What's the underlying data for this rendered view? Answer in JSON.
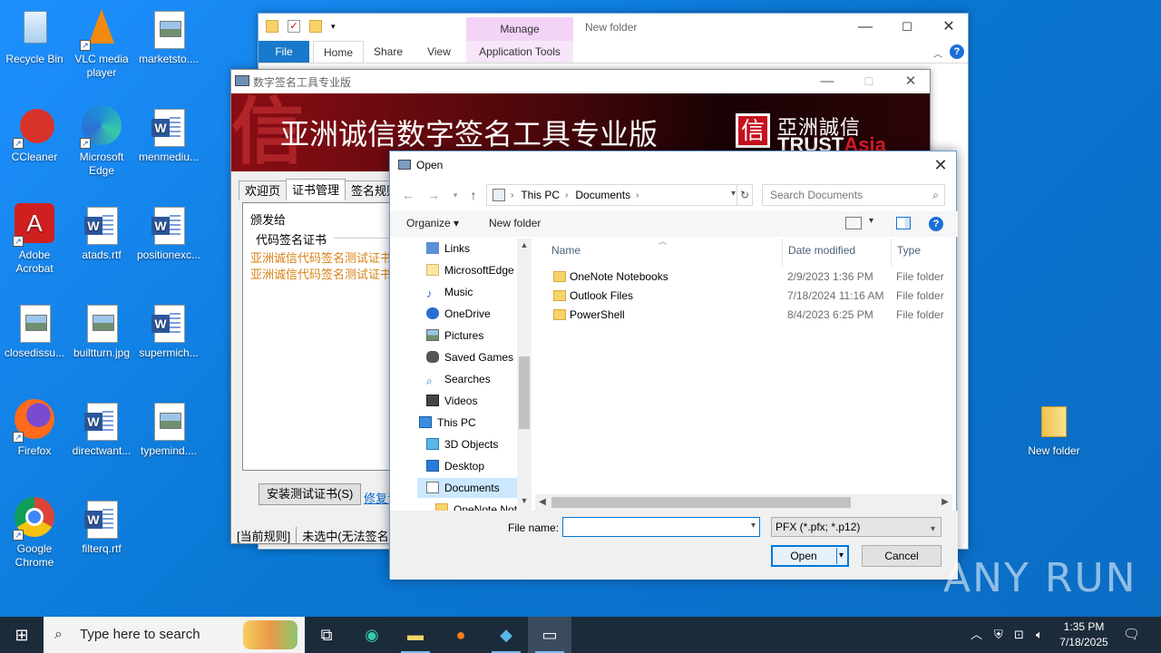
{
  "desktop": {
    "icons": [
      {
        "label": "Recycle Bin"
      },
      {
        "label": "VLC media player"
      },
      {
        "label": "marketsto...."
      },
      {
        "label": "CCleaner"
      },
      {
        "label": "Microsoft Edge"
      },
      {
        "label": "menmediu..."
      },
      {
        "label": "Adobe Acrobat"
      },
      {
        "label": "atads.rtf"
      },
      {
        "label": "positionexc..."
      },
      {
        "label": "closedissu..."
      },
      {
        "label": "builtturn.jpg"
      },
      {
        "label": "supermich..."
      },
      {
        "label": "Firefox"
      },
      {
        "label": "directwant..."
      },
      {
        "label": "typemind...."
      },
      {
        "label": "Google Chrome"
      },
      {
        "label": "filterq.rtf"
      },
      {
        "label": "New folder"
      }
    ]
  },
  "explorer": {
    "caption": "New folder",
    "manage_tab": "Manage",
    "tabs": {
      "file": "File",
      "home": "Home",
      "share": "Share",
      "view": "View",
      "app_tools": "Application Tools"
    }
  },
  "signapp": {
    "title": "数字签名工具专业版",
    "banner_title": "亚洲诚信数字签名工具专业版",
    "logo_cn": "亞洲誠信",
    "logo_en_a": "TRUST",
    "logo_en_b": "Asia",
    "tabs": [
      "欢迎页",
      "证书管理",
      "签名规则"
    ],
    "panel": {
      "label": "颁发给",
      "group": "代码签名证书",
      "entries": [
        "亚洲诚信代码签名测试证书",
        "亚洲诚信代码签名测试证书"
      ]
    },
    "install_button": "安装测试证书(S)",
    "link": "修复证",
    "status": [
      "[当前规则]",
      "未选中(无法签名"
    ]
  },
  "dialog": {
    "title": "Open",
    "address": [
      "This PC",
      "Documents"
    ],
    "search_placeholder": "Search Documents",
    "toolbar": {
      "organize": "Organize",
      "new_folder": "New folder"
    },
    "nav_items": [
      {
        "label": "Links"
      },
      {
        "label": "MicrosoftEdge"
      },
      {
        "label": "Music"
      },
      {
        "label": "OneDrive"
      },
      {
        "label": "Pictures"
      },
      {
        "label": "Saved Games"
      },
      {
        "label": "Searches"
      },
      {
        "label": "Videos"
      },
      {
        "label": "This PC"
      },
      {
        "label": "3D Objects"
      },
      {
        "label": "Desktop"
      },
      {
        "label": "Documents"
      },
      {
        "label": "OneNote Not"
      }
    ],
    "columns": {
      "name": "Name",
      "date": "Date modified",
      "type": "Type"
    },
    "files": [
      {
        "name": "OneNote Notebooks",
        "date": "2/9/2023 1:36 PM",
        "type": "File folder"
      },
      {
        "name": "Outlook Files",
        "date": "7/18/2024 11:16 AM",
        "type": "File folder"
      },
      {
        "name": "PowerShell",
        "date": "8/4/2023 6:25 PM",
        "type": "File folder"
      }
    ],
    "file_name_label": "File name:",
    "file_name_value": "",
    "file_type": "PFX (*.pfx; *.p12)",
    "open_button": "Open",
    "cancel_button": "Cancel"
  },
  "taskbar": {
    "search_placeholder": "Type here to search",
    "time": "1:35 PM",
    "date": "7/18/2025"
  },
  "watermark": "ANY RUN"
}
